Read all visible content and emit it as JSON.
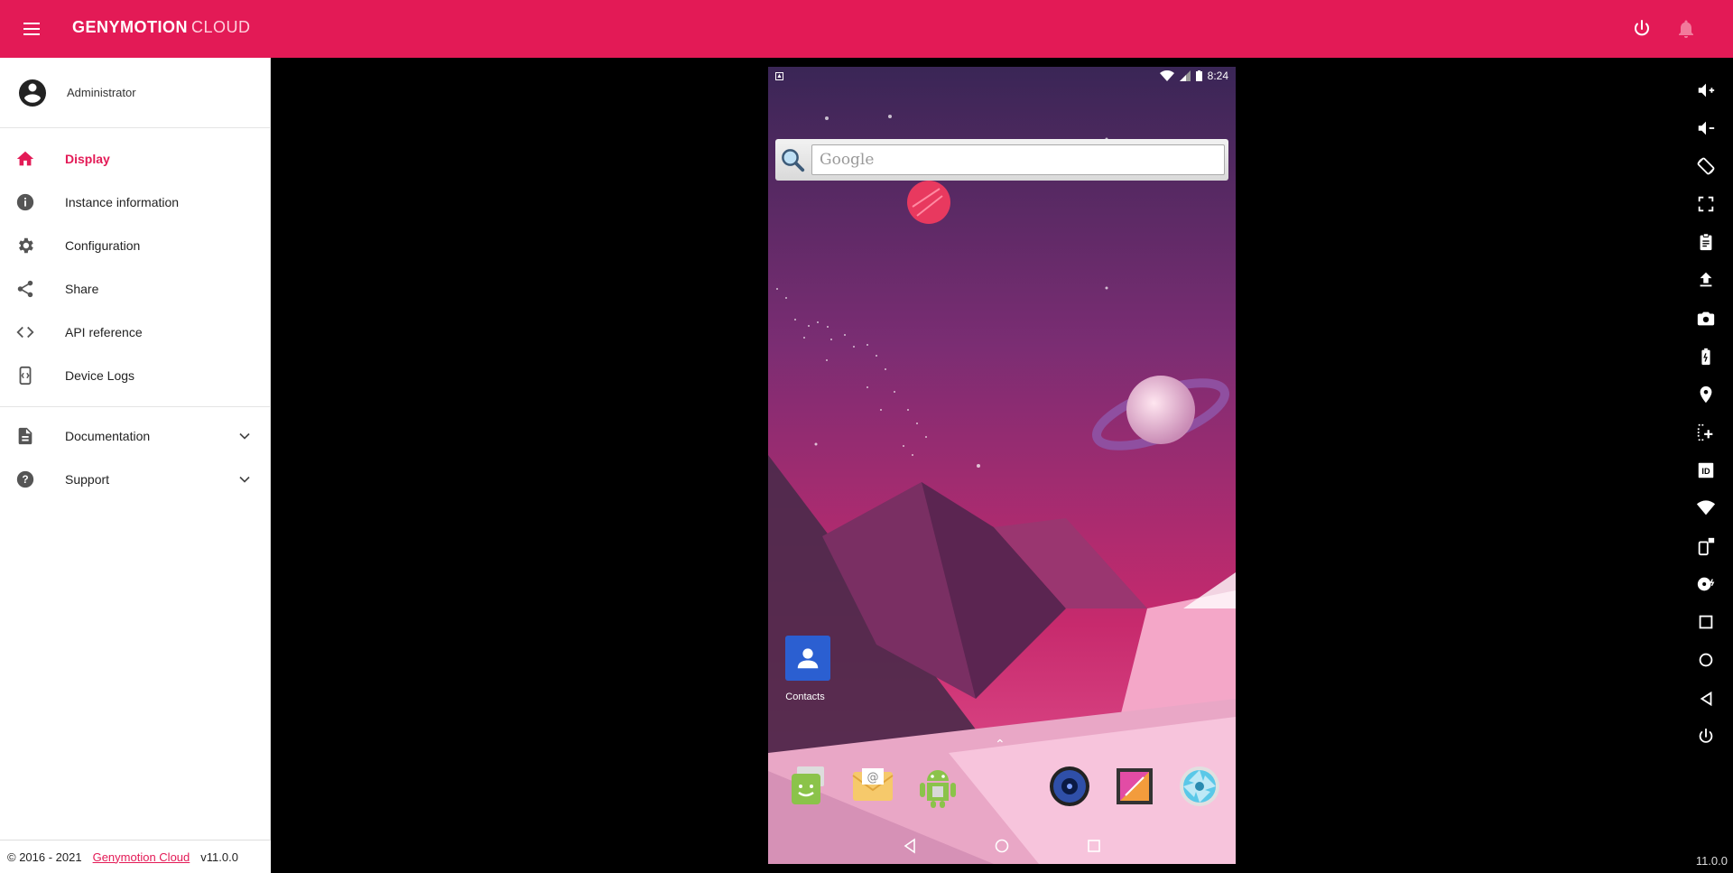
{
  "header": {
    "brand": "GENYMOTION",
    "brand_suffix": "CLOUD",
    "accent_color": "#e31a56"
  },
  "sidebar": {
    "user": {
      "name": "Administrator",
      "icon": "account-circle-icon"
    },
    "items": [
      {
        "label": "Display",
        "icon": "home-icon",
        "active": true
      },
      {
        "label": "Instance information",
        "icon": "info-icon"
      },
      {
        "label": "Configuration",
        "icon": "gear-icon"
      },
      {
        "label": "Share",
        "icon": "share-icon"
      },
      {
        "label": "API reference",
        "icon": "code-icon"
      },
      {
        "label": "Device Logs",
        "icon": "logs-icon"
      }
    ],
    "secondary": [
      {
        "label": "Documentation",
        "icon": "document-icon",
        "expandable": true
      },
      {
        "label": "Support",
        "icon": "help-icon",
        "expandable": true
      }
    ],
    "footer": {
      "copyright": "© 2016 - 2021",
      "link": "Genymotion Cloud",
      "version": "v11.0.0"
    }
  },
  "device": {
    "status": {
      "time": "8:24"
    },
    "search": {
      "placeholder": "Google"
    },
    "contacts": {
      "label": "Contacts"
    },
    "dock_apps": [
      "messaging-app-icon",
      "email-app-icon",
      "genymotion-app-icon",
      "music-app-icon",
      "gallery-app-icon",
      "camera-app-icon"
    ]
  },
  "toolbar": [
    "volume-up-icon",
    "volume-down-icon",
    "rotate-icon",
    "fullscreen-icon",
    "clipboard-icon",
    "upload-icon",
    "camera-icon",
    "battery-icon",
    "gps-icon",
    "multitouch-icon",
    "device-id-icon",
    "wifi-icon",
    "phone-icon",
    "disk-io-icon",
    "recent-apps-icon",
    "home-circle-icon",
    "back-icon",
    "power-icon"
  ],
  "app_version": "11.0.0"
}
